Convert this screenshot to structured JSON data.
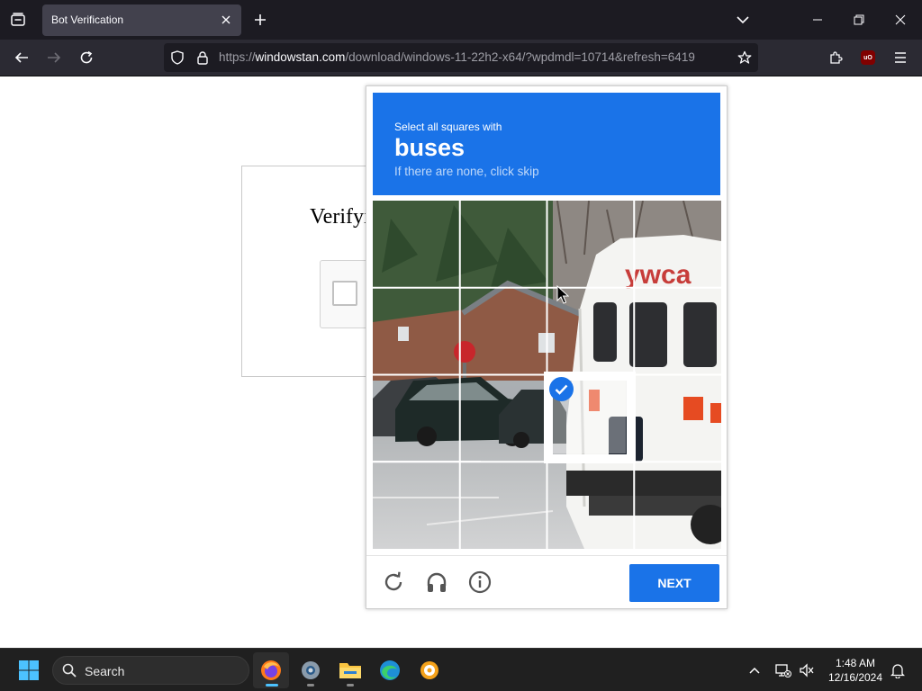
{
  "browser": {
    "tab": {
      "title": "Bot Verification"
    },
    "url": {
      "prefix": "https://",
      "domain": "windowstan.com",
      "path": "/download/windows-11-22h2-x64/?wpdmdl=10714&refresh=6419"
    }
  },
  "page": {
    "verify_title": "Verifyi"
  },
  "captcha": {
    "instruction": "Select all squares with",
    "target": "buses",
    "sub": "If there are none, click skip",
    "tiles": [
      {
        "selected": false
      },
      {
        "selected": false
      },
      {
        "selected": false
      },
      {
        "selected": false
      },
      {
        "selected": false
      },
      {
        "selected": false
      },
      {
        "selected": false
      },
      {
        "selected": false
      },
      {
        "selected": false
      },
      {
        "selected": false
      },
      {
        "selected": true
      },
      {
        "selected": false
      },
      {
        "selected": false
      },
      {
        "selected": false
      },
      {
        "selected": false
      },
      {
        "selected": false
      }
    ],
    "bus_sign": "ywca",
    "next_label": "NEXT",
    "icons": [
      "reload-icon",
      "headphones-icon",
      "info-icon"
    ]
  },
  "taskbar": {
    "search_placeholder": "Search",
    "time": "1:48 AM",
    "date": "12/16/2024",
    "apps": [
      "firefox-icon",
      "settings-icon",
      "file-explorer-icon",
      "edge-icon",
      "media-app-icon"
    ]
  },
  "colors": {
    "accent": "#1a73e8",
    "tabbar": "#1c1b22",
    "navbar": "#2b2a33",
    "taskbar": "#202020"
  }
}
